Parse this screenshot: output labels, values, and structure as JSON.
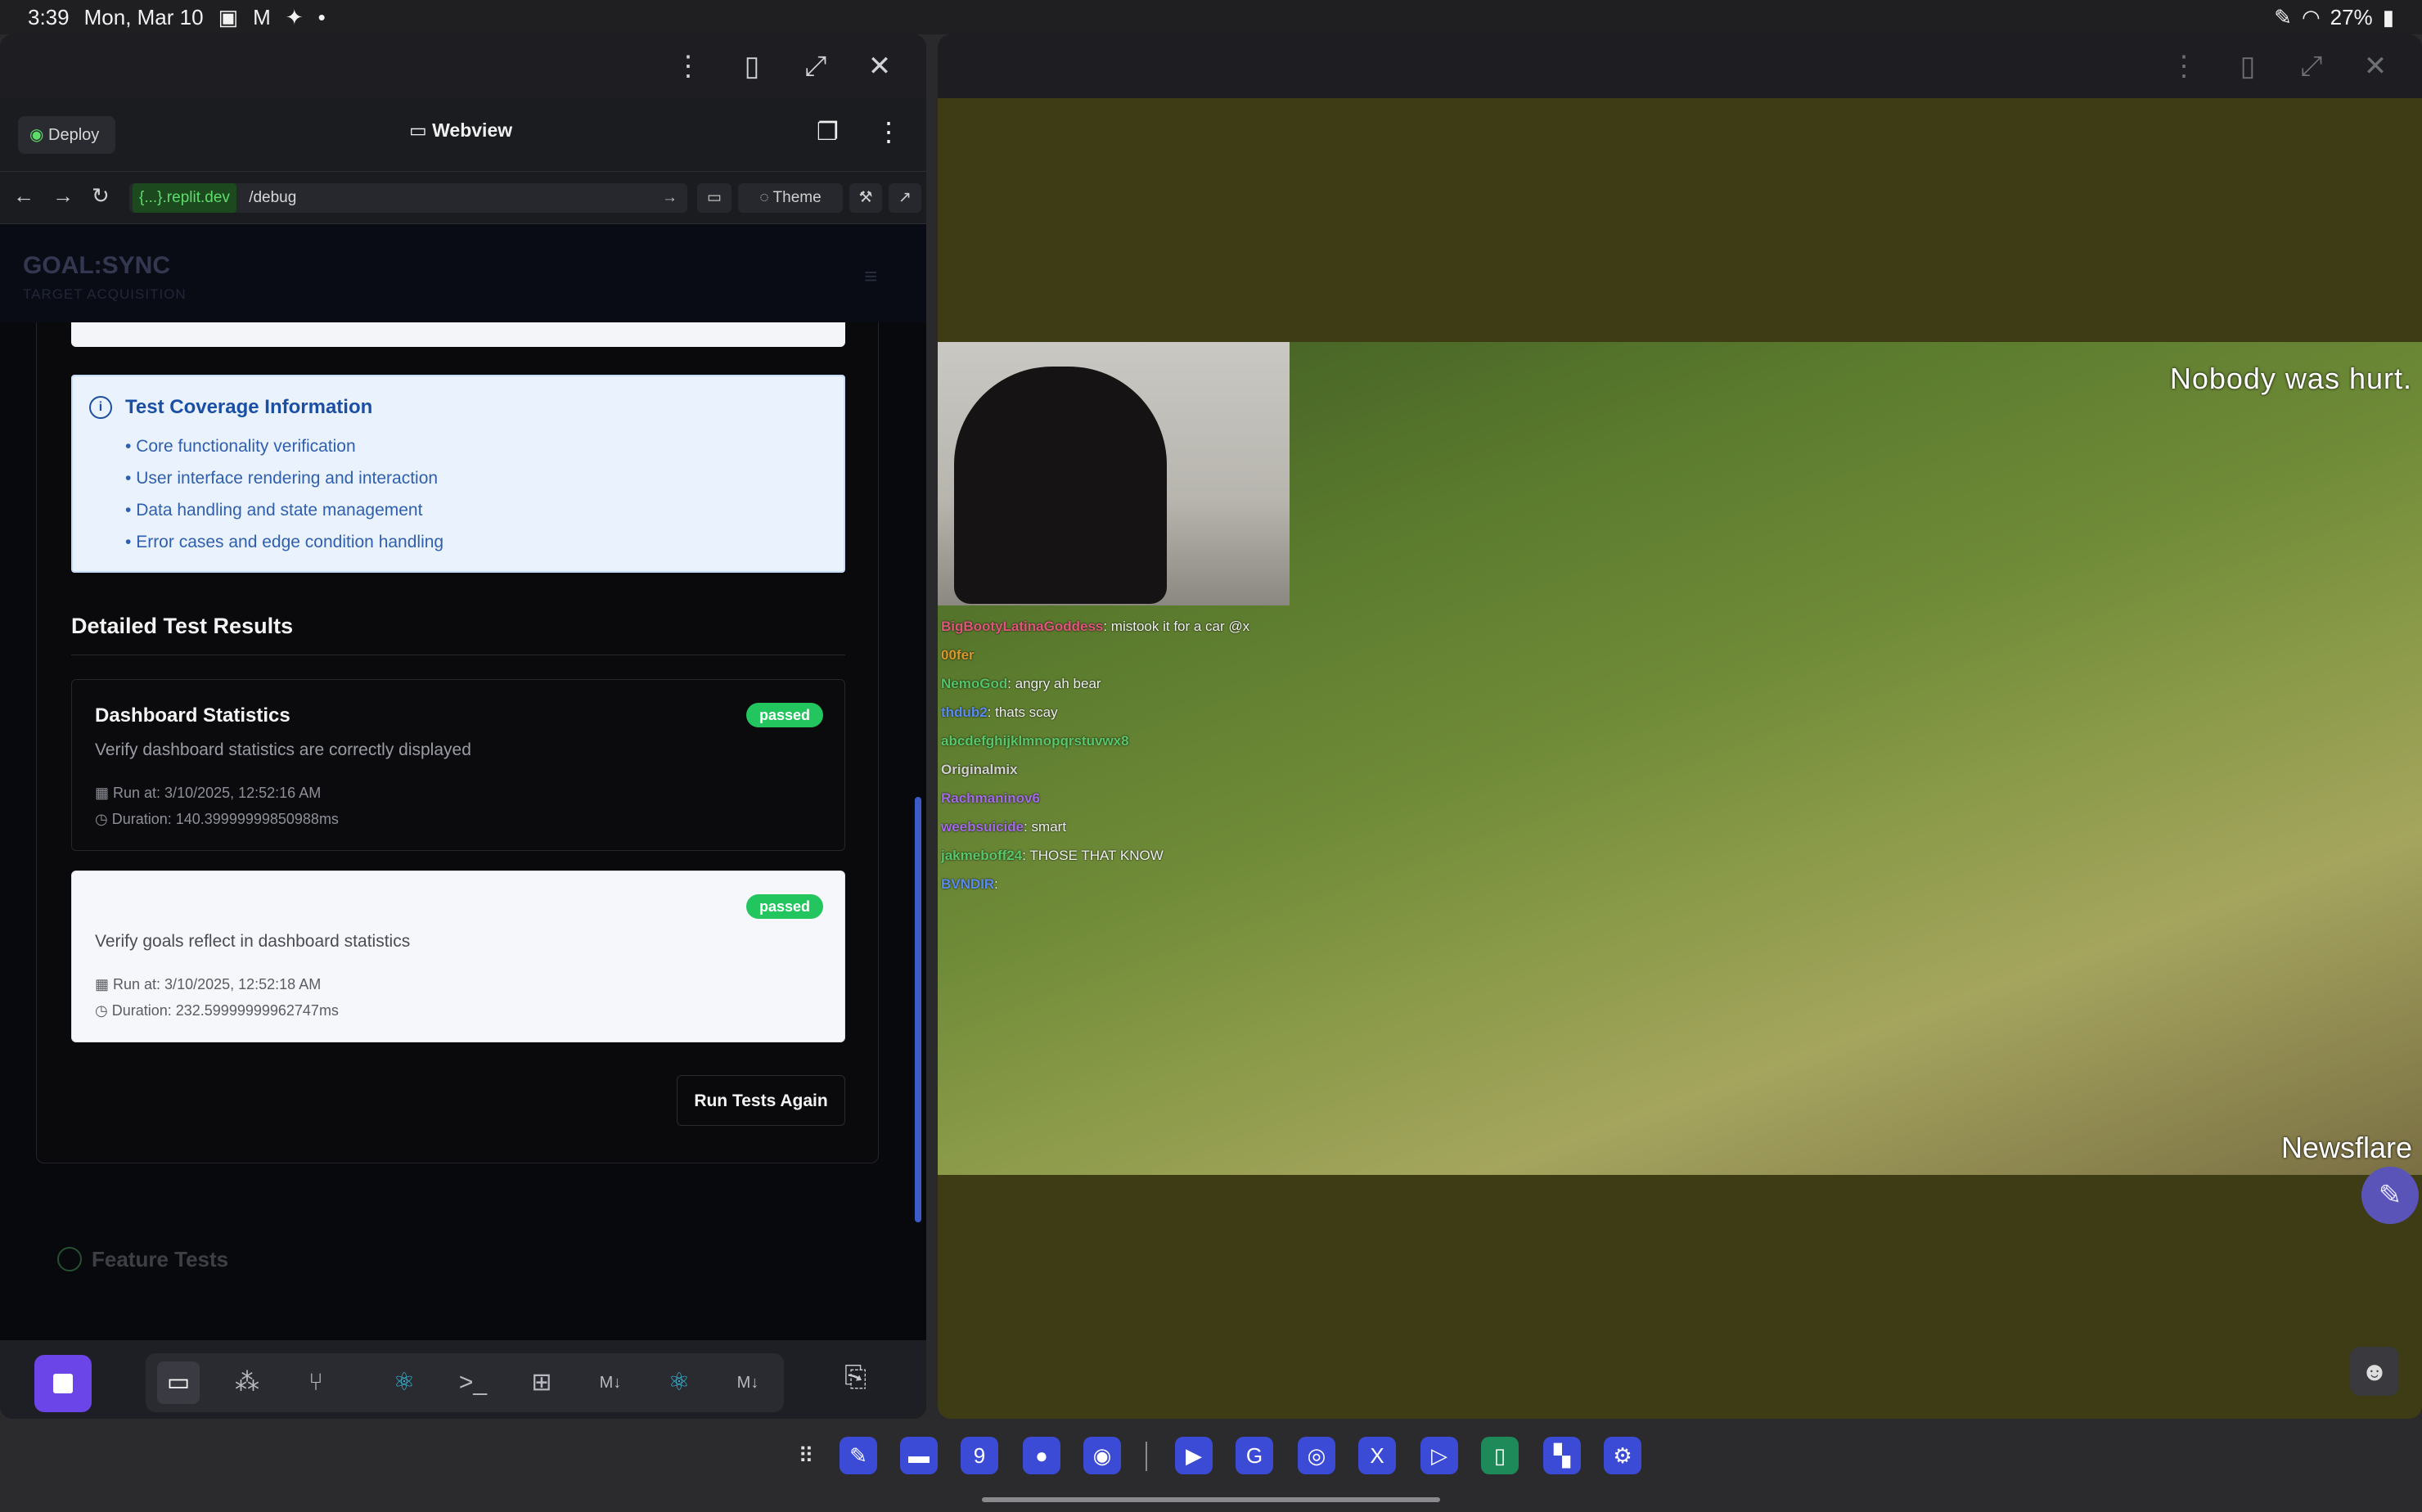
{
  "status_bar": {
    "time": "3:39",
    "date": "Mon, Mar 10",
    "battery": "27%"
  },
  "replit": {
    "deploy_label": "Deploy",
    "webview_title": "Webview",
    "url_host": "{...}.replit.dev",
    "url_path": "/debug",
    "theme_label": "Theme"
  },
  "app": {
    "title": "GOAL:SYNC",
    "subtitle": "TARGET ACQUISITION",
    "info": {
      "title": "Test Coverage Information",
      "items": [
        "Core functionality verification",
        "User interface rendering and interaction",
        "Data handling and state management",
        "Error cases and edge condition handling"
      ]
    },
    "results_heading": "Detailed Test Results",
    "tests": [
      {
        "title": "Dashboard Statistics",
        "description": "Verify dashboard statistics are correctly displayed",
        "status": "passed",
        "run_at": "Run at: 3/10/2025, 12:52:16 AM",
        "duration": "Duration: 140.39999999850988ms"
      },
      {
        "title": "",
        "description": "Verify goals reflect in dashboard statistics",
        "status": "passed",
        "run_at": "Run at: 3/10/2025, 12:52:18 AM",
        "duration": "Duration: 232.59999999962747ms"
      }
    ],
    "run_again_label": "Run Tests Again",
    "feature_section_title": "Feature Tests"
  },
  "video": {
    "caption": "Nobody was hurt.",
    "watermark": "Newsflare",
    "chat": [
      {
        "user": "BigBootyLatinaGoddess",
        "user_color": "#e0567a",
        "text": ": mistook it for a car @x"
      },
      {
        "user": "00fer",
        "user_color": "#d99a2b",
        "text": ""
      },
      {
        "user": "NemoGod",
        "user_color": "#53c46a",
        "text": ": angry ah bear"
      },
      {
        "user": "thdub2",
        "user_color": "#5a8cf0",
        "text": ": thats scay"
      },
      {
        "user": "abcdefghijklmnopqrstuvwx8",
        "user_color": "#59c76b",
        "text": ""
      },
      {
        "user": "Originalmix",
        "user_color": "#d0d0d0",
        "text": ""
      },
      {
        "user": "Rachmaninov6",
        "user_color": "#a36be8",
        "text": ""
      },
      {
        "user": "weebsuicide",
        "user_color": "#a36be8",
        "text": ": smart"
      },
      {
        "user": "jakmeboff24",
        "user_color": "#59c76b",
        "text": ": THOSE THAT KNOW"
      },
      {
        "user": "BVNDIR",
        "user_color": "#5a8cf0",
        "text": ":"
      }
    ]
  },
  "colors": {
    "accent": "#6b45e8",
    "passed": "#22c55e",
    "info_bg": "#eaf2fd",
    "info_text": "#1b4fa3"
  }
}
